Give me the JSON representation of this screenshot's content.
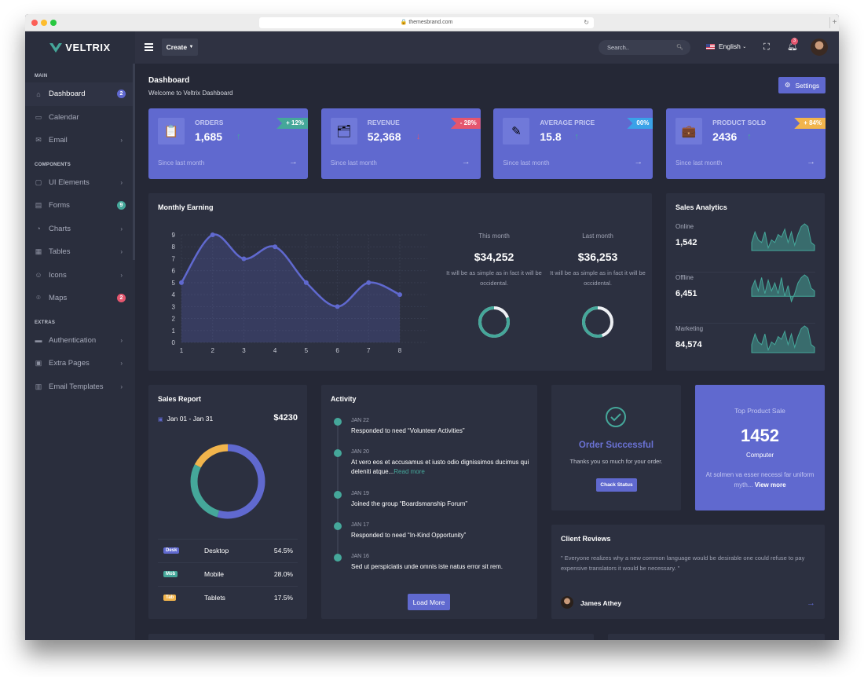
{
  "browser": {
    "url": "themesbrand.com"
  },
  "brand": {
    "name": "VELTRIX"
  },
  "sidebar": {
    "sections": [
      {
        "title": "MAIN",
        "items": [
          {
            "label": "Dashboard",
            "icon": "home-icon",
            "badge": "2",
            "badge_color": "#5f68cf",
            "active": true
          },
          {
            "label": "Calendar",
            "icon": "calendar-icon"
          },
          {
            "label": "Email",
            "icon": "mail-icon",
            "chevron": true
          }
        ]
      },
      {
        "title": "COMPONENTS",
        "items": [
          {
            "label": "UI Elements",
            "icon": "box-icon",
            "chevron": true
          },
          {
            "label": "Forms",
            "icon": "form-icon",
            "badge": "9",
            "badge_color": "#45a79a"
          },
          {
            "label": "Charts",
            "icon": "pie-chart-icon",
            "chevron": true
          },
          {
            "label": "Tables",
            "icon": "grid-icon",
            "chevron": true
          },
          {
            "label": "Icons",
            "icon": "smile-icon",
            "chevron": true
          },
          {
            "label": "Maps",
            "icon": "map-pin-icon",
            "badge": "2",
            "badge_color": "#e4566e"
          }
        ]
      },
      {
        "title": "EXTRAS",
        "items": [
          {
            "label": "Authentication",
            "icon": "lock-box-icon",
            "chevron": true
          },
          {
            "label": "Extra Pages",
            "icon": "briefcase-icon",
            "chevron": true
          },
          {
            "label": "Email Templates",
            "icon": "template-icon",
            "chevron": true
          }
        ]
      }
    ]
  },
  "topbar": {
    "create_label": "Create",
    "search_placeholder": "Search..",
    "language": "English",
    "notification_count": "3"
  },
  "page": {
    "title": "Dashboard",
    "subtitle": "Welcome to Veltrix Dashboard",
    "settings_label": "Settings"
  },
  "stats": [
    {
      "label": "ORDERS",
      "value": "1,685",
      "change": "+ 12%",
      "ribbon_color": "#45a79a",
      "trend": "up",
      "since": "Since last month",
      "icon": "orders-icon"
    },
    {
      "label": "REVENUE",
      "value": "52,368",
      "change": "- 28%",
      "ribbon_color": "#e4566e",
      "trend": "down",
      "since": "Since last month",
      "icon": "revenue-icon"
    },
    {
      "label": "AVERAGE PRICE",
      "value": "15.8",
      "change": "00%",
      "ribbon_color": "#3aa2e8",
      "trend": "up",
      "since": "Since last month",
      "icon": "pen-icon"
    },
    {
      "label": "PRODUCT SOLD",
      "value": "2436",
      "change": "+ 84%",
      "ribbon_color": "#f1b44c",
      "trend": "up",
      "since": "Since last month",
      "icon": "briefcase-icon"
    }
  ],
  "monthly_earning": {
    "title": "Monthly Earning",
    "this_month": {
      "label": "This month",
      "value": "$34,252",
      "desc": "It will be as simple as in fact it will be occidental.",
      "progress": 0.8
    },
    "last_month": {
      "label": "Last month",
      "value": "$36,253",
      "desc": "It will be as simple as in fact it will be occidental.",
      "progress": 0.55
    }
  },
  "chart_data": {
    "type": "area",
    "title": "Monthly Earning",
    "x": [
      1,
      2,
      3,
      4,
      5,
      6,
      7,
      8
    ],
    "series": [
      {
        "name": "Earning",
        "values": [
          5,
          9,
          7,
          8,
          5,
          3,
          5,
          4
        ]
      }
    ],
    "xlabel": "",
    "ylabel": "",
    "ylim": [
      0,
      9
    ],
    "yticks": [
      0,
      1,
      2,
      3,
      4,
      5,
      6,
      7,
      8,
      9
    ],
    "grid": true,
    "color": "#6069cf"
  },
  "sales_analytics": {
    "title": "Sales Analytics",
    "rows": [
      {
        "label": "Online",
        "value": "1,542",
        "spark": [
          3,
          7,
          4,
          3,
          7,
          1,
          4,
          3,
          6,
          5,
          8,
          3,
          7,
          2,
          6,
          9,
          10,
          9,
          3,
          2
        ]
      },
      {
        "label": "Offline",
        "value": "6,451",
        "spark": [
          3,
          6,
          2,
          7,
          1,
          6,
          2,
          5,
          1,
          7,
          0,
          4,
          -2,
          1,
          5,
          7,
          8,
          7,
          3,
          2
        ]
      },
      {
        "label": "Marketing",
        "value": "84,574",
        "spark": [
          3,
          7,
          4,
          3,
          7,
          1,
          4,
          3,
          6,
          5,
          8,
          3,
          7,
          2,
          6,
          9,
          10,
          9,
          3,
          2
        ]
      }
    ]
  },
  "sales_report": {
    "title": "Sales Report",
    "date_range": "Jan 01 - Jan 31",
    "total": "$4230",
    "rows": [
      {
        "tag": "Desk",
        "name": "Desktop",
        "percent": "54.5%",
        "value": 54.5,
        "color": "#6069cf"
      },
      {
        "tag": "Mob",
        "name": "Mobile",
        "percent": "28.0%",
        "value": 28.0,
        "color": "#45a79a"
      },
      {
        "tag": "Tab",
        "name": "Tablets",
        "percent": "17.5%",
        "value": 17.5,
        "color": "#f1b44c"
      }
    ]
  },
  "activity": {
    "title": "Activity",
    "items": [
      {
        "date": "JAN 22",
        "text": "Responded to need “Volunteer Activities”"
      },
      {
        "date": "JAN 20",
        "text": "At vero eos et accusamus et iusto odio dignissimos ducimus qui deleniti atque...",
        "link": "Read more"
      },
      {
        "date": "JAN 19",
        "text": "Joined the group “Boardsmanship Forum”"
      },
      {
        "date": "JAN 17",
        "text": "Responded to need “In-Kind Opportunity”"
      },
      {
        "date": "JAN 16",
        "text": "Sed ut perspiciatis unde omnis iste natus error sit rem."
      }
    ],
    "load_more": "Load More"
  },
  "order": {
    "title": "Order Successful",
    "text": "Thanks you so much for your order.",
    "button": "Chack Status"
  },
  "top_product": {
    "title": "Top Product Sale",
    "value": "1452",
    "name": "Computer",
    "desc": "At solmen va esser necessi far uniform myth...",
    "link": "View more"
  },
  "reviews": {
    "title": "Client Reviews",
    "quote": "\" Everyone realizes why a new common language would be desirable one could refuse to pay expensive translators it would be necessary. \"",
    "author": "James Athey"
  }
}
